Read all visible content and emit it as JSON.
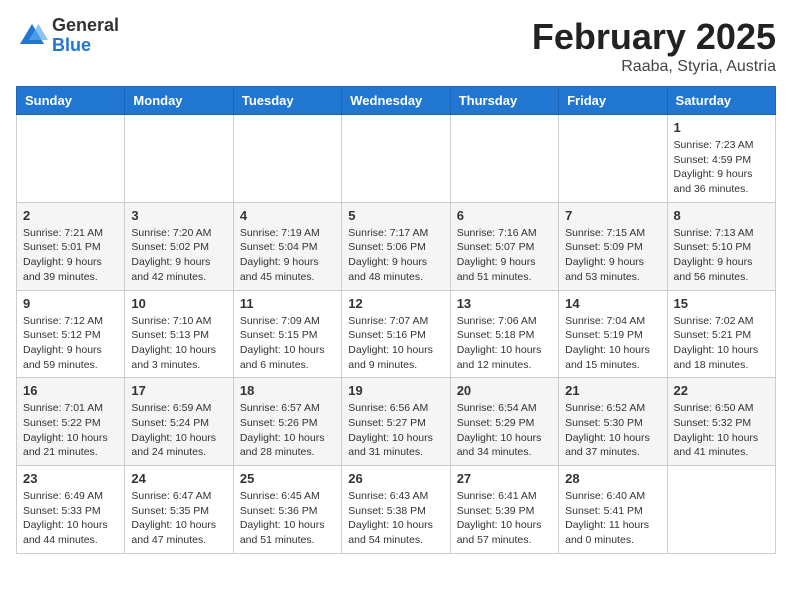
{
  "logo": {
    "general": "General",
    "blue": "Blue"
  },
  "header": {
    "month": "February 2025",
    "location": "Raaba, Styria, Austria"
  },
  "days_of_week": [
    "Sunday",
    "Monday",
    "Tuesday",
    "Wednesday",
    "Thursday",
    "Friday",
    "Saturday"
  ],
  "weeks": [
    [
      {
        "day": "",
        "info": ""
      },
      {
        "day": "",
        "info": ""
      },
      {
        "day": "",
        "info": ""
      },
      {
        "day": "",
        "info": ""
      },
      {
        "day": "",
        "info": ""
      },
      {
        "day": "",
        "info": ""
      },
      {
        "day": "1",
        "info": "Sunrise: 7:23 AM\nSunset: 4:59 PM\nDaylight: 9 hours and 36 minutes."
      }
    ],
    [
      {
        "day": "2",
        "info": "Sunrise: 7:21 AM\nSunset: 5:01 PM\nDaylight: 9 hours and 39 minutes."
      },
      {
        "day": "3",
        "info": "Sunrise: 7:20 AM\nSunset: 5:02 PM\nDaylight: 9 hours and 42 minutes."
      },
      {
        "day": "4",
        "info": "Sunrise: 7:19 AM\nSunset: 5:04 PM\nDaylight: 9 hours and 45 minutes."
      },
      {
        "day": "5",
        "info": "Sunrise: 7:17 AM\nSunset: 5:06 PM\nDaylight: 9 hours and 48 minutes."
      },
      {
        "day": "6",
        "info": "Sunrise: 7:16 AM\nSunset: 5:07 PM\nDaylight: 9 hours and 51 minutes."
      },
      {
        "day": "7",
        "info": "Sunrise: 7:15 AM\nSunset: 5:09 PM\nDaylight: 9 hours and 53 minutes."
      },
      {
        "day": "8",
        "info": "Sunrise: 7:13 AM\nSunset: 5:10 PM\nDaylight: 9 hours and 56 minutes."
      }
    ],
    [
      {
        "day": "9",
        "info": "Sunrise: 7:12 AM\nSunset: 5:12 PM\nDaylight: 9 hours and 59 minutes."
      },
      {
        "day": "10",
        "info": "Sunrise: 7:10 AM\nSunset: 5:13 PM\nDaylight: 10 hours and 3 minutes."
      },
      {
        "day": "11",
        "info": "Sunrise: 7:09 AM\nSunset: 5:15 PM\nDaylight: 10 hours and 6 minutes."
      },
      {
        "day": "12",
        "info": "Sunrise: 7:07 AM\nSunset: 5:16 PM\nDaylight: 10 hours and 9 minutes."
      },
      {
        "day": "13",
        "info": "Sunrise: 7:06 AM\nSunset: 5:18 PM\nDaylight: 10 hours and 12 minutes."
      },
      {
        "day": "14",
        "info": "Sunrise: 7:04 AM\nSunset: 5:19 PM\nDaylight: 10 hours and 15 minutes."
      },
      {
        "day": "15",
        "info": "Sunrise: 7:02 AM\nSunset: 5:21 PM\nDaylight: 10 hours and 18 minutes."
      }
    ],
    [
      {
        "day": "16",
        "info": "Sunrise: 7:01 AM\nSunset: 5:22 PM\nDaylight: 10 hours and 21 minutes."
      },
      {
        "day": "17",
        "info": "Sunrise: 6:59 AM\nSunset: 5:24 PM\nDaylight: 10 hours and 24 minutes."
      },
      {
        "day": "18",
        "info": "Sunrise: 6:57 AM\nSunset: 5:26 PM\nDaylight: 10 hours and 28 minutes."
      },
      {
        "day": "19",
        "info": "Sunrise: 6:56 AM\nSunset: 5:27 PM\nDaylight: 10 hours and 31 minutes."
      },
      {
        "day": "20",
        "info": "Sunrise: 6:54 AM\nSunset: 5:29 PM\nDaylight: 10 hours and 34 minutes."
      },
      {
        "day": "21",
        "info": "Sunrise: 6:52 AM\nSunset: 5:30 PM\nDaylight: 10 hours and 37 minutes."
      },
      {
        "day": "22",
        "info": "Sunrise: 6:50 AM\nSunset: 5:32 PM\nDaylight: 10 hours and 41 minutes."
      }
    ],
    [
      {
        "day": "23",
        "info": "Sunrise: 6:49 AM\nSunset: 5:33 PM\nDaylight: 10 hours and 44 minutes."
      },
      {
        "day": "24",
        "info": "Sunrise: 6:47 AM\nSunset: 5:35 PM\nDaylight: 10 hours and 47 minutes."
      },
      {
        "day": "25",
        "info": "Sunrise: 6:45 AM\nSunset: 5:36 PM\nDaylight: 10 hours and 51 minutes."
      },
      {
        "day": "26",
        "info": "Sunrise: 6:43 AM\nSunset: 5:38 PM\nDaylight: 10 hours and 54 minutes."
      },
      {
        "day": "27",
        "info": "Sunrise: 6:41 AM\nSunset: 5:39 PM\nDaylight: 10 hours and 57 minutes."
      },
      {
        "day": "28",
        "info": "Sunrise: 6:40 AM\nSunset: 5:41 PM\nDaylight: 11 hours and 0 minutes."
      },
      {
        "day": "",
        "info": ""
      }
    ]
  ]
}
